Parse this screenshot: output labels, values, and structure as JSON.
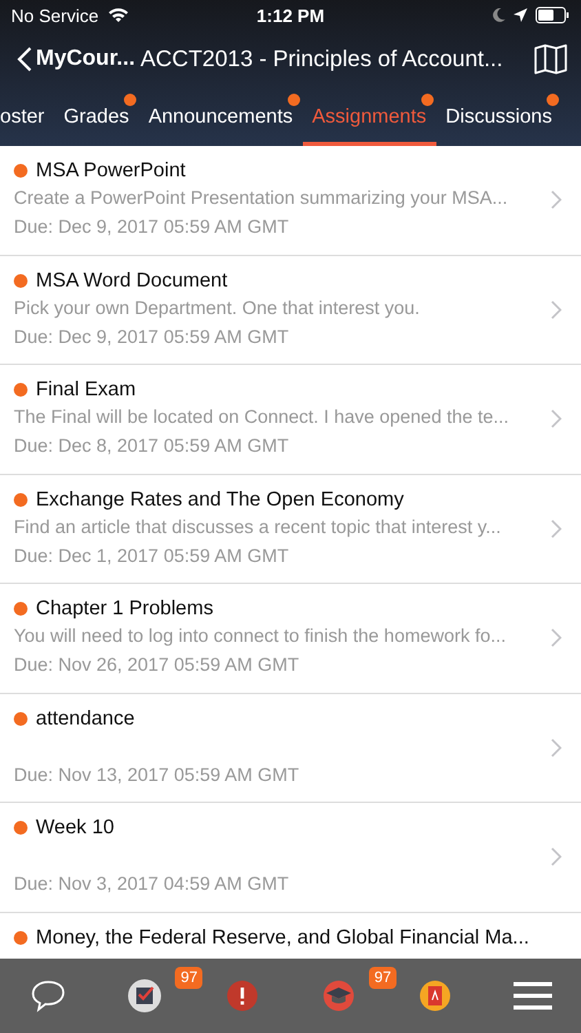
{
  "status_bar": {
    "carrier": "No Service",
    "time": "1:12 PM"
  },
  "nav": {
    "back_label": "MyCour...",
    "title": "ACCT2013 - Principles of Account..."
  },
  "tabs": [
    {
      "label": "oster",
      "selected": false,
      "dot": false
    },
    {
      "label": "Grades",
      "selected": false,
      "dot": true
    },
    {
      "label": "Announcements",
      "selected": false,
      "dot": true
    },
    {
      "label": "Assignments",
      "selected": true,
      "dot": true
    },
    {
      "label": "Discussions",
      "selected": false,
      "dot": true
    }
  ],
  "assignments": [
    {
      "title": "MSA PowerPoint",
      "description": "Create a PowerPoint Presentation summarizing your MSA...",
      "due": "Due: Dec 9, 2017 05:59 AM GMT",
      "unread": true
    },
    {
      "title": "MSA Word Document",
      "description": "Pick your own Department. One that interest you.",
      "due": "Due: Dec 9, 2017 05:59 AM GMT",
      "unread": true
    },
    {
      "title": "Final Exam",
      "description": "The Final will be located on Connect. I have opened the te...",
      "due": "Due: Dec 8, 2017 05:59 AM GMT",
      "unread": true
    },
    {
      "title": "Exchange Rates and The Open Economy",
      "description": "Find an article that discusses a recent topic that interest y...",
      "due": "Due: Dec 1, 2017 05:59 AM GMT",
      "unread": true
    },
    {
      "title": "Chapter 1 Problems",
      "description": "You will need to log into connect to finish the homework fo...",
      "due": "Due: Nov 26, 2017 05:59 AM GMT",
      "unread": true
    },
    {
      "title": "attendance",
      "due": "Due: Nov 13, 2017 05:59 AM GMT",
      "unread": true
    },
    {
      "title": "Week 10",
      "due": "Due: Nov 3, 2017 04:59 AM GMT",
      "unread": true
    },
    {
      "title": "Money, the Federal Reserve, and Global Financial Ma...",
      "unread": true
    }
  ],
  "bottom_bar": [
    {
      "kind": "chat"
    },
    {
      "kind": "checklist",
      "badge": "97"
    },
    {
      "kind": "alert"
    },
    {
      "kind": "cap",
      "badge": "97"
    },
    {
      "kind": "book"
    },
    {
      "kind": "menu"
    }
  ]
}
